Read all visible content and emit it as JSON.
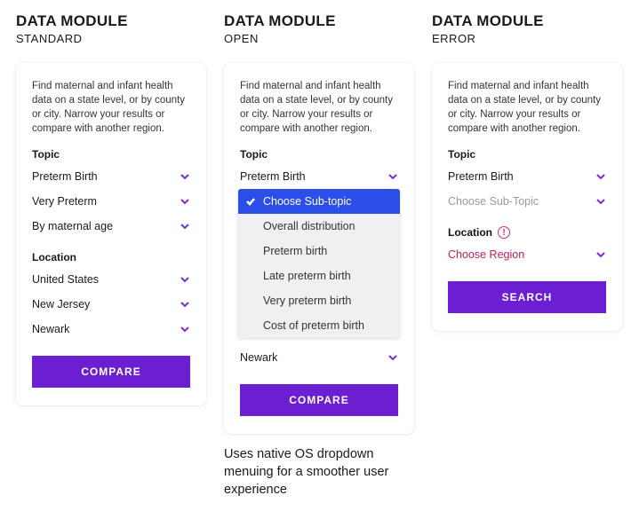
{
  "columns": {
    "standard": {
      "title": "DATA MODULE",
      "sub": "STANDARD"
    },
    "open": {
      "title": "DATA MODULE",
      "sub": "OPEN"
    },
    "error": {
      "title": "DATA MODULE",
      "sub": "ERROR"
    }
  },
  "card": {
    "description": "Find maternal and infant health data on a state level, or by county or city. Narrow your results or compare with another region.",
    "topic_label": "Topic",
    "location_label": "Location"
  },
  "standard": {
    "topic_rows": [
      "Preterm Birth",
      "Very Preterm",
      "By maternal age"
    ],
    "location_rows": [
      "United States",
      "New Jersey",
      "Newark"
    ],
    "button": "COMPARE"
  },
  "open": {
    "topic_selected": "Preterm Birth",
    "dropdown": {
      "selected": "Choose Sub-topic",
      "options": [
        "Overall distribution",
        "Preterm birth",
        "Late preterm birth",
        "Very preterm birth",
        "Cost of preterm birth"
      ]
    },
    "location_row": "Newark",
    "button": "COMPARE",
    "footnote": "Uses native OS dropdown menuing for a smoother user experience"
  },
  "error": {
    "topic_rows": {
      "selected": "Preterm Birth",
      "placeholder": "Choose Sub-Topic"
    },
    "location_placeholder": "Choose Region",
    "button": "SEARCH"
  }
}
